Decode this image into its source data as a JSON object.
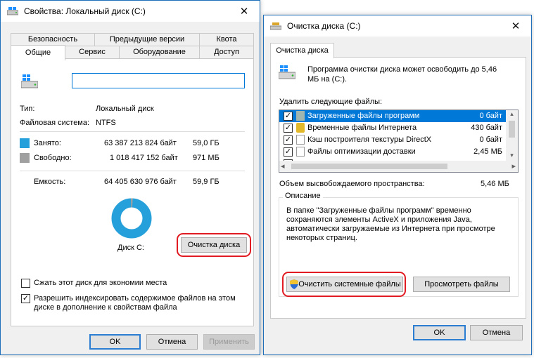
{
  "left_window": {
    "title": "Свойства: Локальный диск (C:)",
    "close_glyph": "✕",
    "tabs_top": [
      "Безопасность",
      "Предыдущие версии",
      "Квота"
    ],
    "tabs_bottom": [
      "Общие",
      "Сервис",
      "Оборудование",
      "Доступ"
    ],
    "name_value": "",
    "type_label": "Тип:",
    "type_value": "Локальный диск",
    "fs_label": "Файловая система:",
    "fs_value": "NTFS",
    "used_label": "Занято:",
    "used_bytes": "63 387 213 824 байт",
    "used_size": "59,0 ГБ",
    "free_label": "Свободно:",
    "free_bytes": "1 018 417 152 байт",
    "free_size": "971 МБ",
    "capacity_label": "Емкость:",
    "capacity_bytes": "64 405 630 976 байт",
    "capacity_size": "59,9 ГБ",
    "disk_label": "Диск C:",
    "cleanup_button": "Очистка диска",
    "compress_checkbox": {
      "label": "Сжать этот диск для экономии места",
      "checked": false
    },
    "index_checkbox": {
      "label_line1": "Разрешить индексировать содержимое файлов на этом",
      "label_line2": "диске в дополнение к свойствам файла",
      "checked": true
    },
    "ok_button": "OK",
    "cancel_button": "Отмена",
    "apply_button": "Применить",
    "colors": {
      "used": "#26a0da",
      "free": "#a0a0a0",
      "highlight": "#e11b22"
    }
  },
  "right_window": {
    "title": "Очистка диска  (C:)",
    "close_glyph": "✕",
    "tab": "Очистка диска",
    "intro_line1": "Программа очистки диска может освободить до 5,46",
    "intro_line2": "МБ на  (C:).",
    "files_label": "Удалить следующие файлы:",
    "file_list": [
      {
        "name": "Загруженные файлы программ",
        "size": "0 байт",
        "checked": true,
        "selected": true
      },
      {
        "name": "Временные файлы Интернета",
        "size": "430 байт",
        "checked": true,
        "selected": false
      },
      {
        "name": "Кэш построителя текстуры DirectX",
        "size": "0 байт",
        "checked": true,
        "selected": false
      },
      {
        "name": "Файлы оптимизации доставки",
        "size": "2,45 МБ",
        "checked": true,
        "selected": false
      },
      {
        "name": "",
        "size": "",
        "checked": false,
        "selected": false
      }
    ],
    "scroll_left": "◂",
    "scroll_right": "▸",
    "scroll_up": "▴",
    "scroll_down": "▾",
    "total_label": "Объем высвобождаемого пространства:",
    "total_value": "5,46 МБ",
    "description_legend": "Описание",
    "description_lines": [
      "В папке \"Загруженные файлы программ\" временно",
      "сохраняются элементы ActiveX и приложения Java,",
      "автоматически загружаемые из Интернета при просмотре",
      "некоторых страниц."
    ],
    "cleanup_system_button": "Очистить системные файлы",
    "view_files_button": "Просмотреть файлы",
    "ok_button": "OK",
    "cancel_button": "Отмена",
    "colors": {
      "selection": "#0078d7",
      "highlight": "#e11b22"
    }
  }
}
